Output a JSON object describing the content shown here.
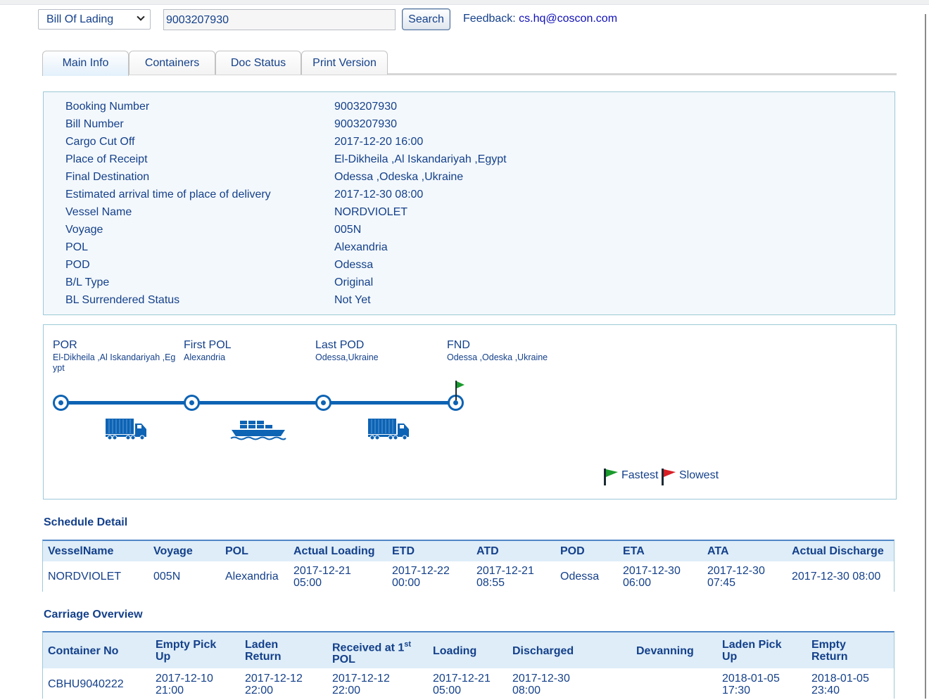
{
  "search": {
    "doc_type": "Bill Of Lading",
    "number": "9003207930",
    "button": "Search",
    "feedback_label": "Feedback:",
    "feedback_email": "cs.hq@coscon.com"
  },
  "tabs": [
    "Main Info",
    "Containers",
    "Doc Status",
    "Print Version"
  ],
  "main_info": [
    {
      "label": "Booking Number",
      "value": "9003207930"
    },
    {
      "label": "Bill Number",
      "value": "9003207930"
    },
    {
      "label": "Cargo Cut Off",
      "value": "2017-12-20 16:00"
    },
    {
      "label": "Place of Receipt",
      "value": "El-Dikheila ,Al Iskandariyah ,Egypt"
    },
    {
      "label": "Final Destination",
      "value": "Odessa ,Odeska ,Ukraine"
    },
    {
      "label": "Estimated arrival time of place of delivery",
      "value": "2017-12-30 08:00"
    },
    {
      "label": "Vessel Name",
      "value": "NORDVIOLET"
    },
    {
      "label": "Voyage",
      "value": "005N"
    },
    {
      "label": "POL",
      "value": "Alexandria"
    },
    {
      "label": "POD",
      "value": "Odessa"
    },
    {
      "label": "B/L Type",
      "value": "Original"
    },
    {
      "label": "BL Surrendered Status",
      "value": "Not Yet"
    }
  ],
  "route": {
    "stops": [
      {
        "name": "POR",
        "place": "El-Dikheila ,Al Iskandariyah ,Egypt"
      },
      {
        "name": "First POL",
        "place": "Alexandria"
      },
      {
        "name": "Last POD",
        "place": "Odessa,Ukraine"
      },
      {
        "name": "FND",
        "place": "Odessa ,Odeska ,Ukraine"
      }
    ],
    "legs": [
      "truck",
      "ship",
      "truck"
    ],
    "legend": {
      "fastest": "Fastest",
      "slowest": "Slowest"
    },
    "colors": {
      "route": "#0d63b4",
      "fastest_flag": "#1a9a2c",
      "slowest_flag": "#d81f26"
    }
  },
  "schedule": {
    "title": "Schedule Detail",
    "headers": [
      "VesselName",
      "Voyage",
      "POL",
      "Actual Loading",
      "ETD",
      "ATD",
      "POD",
      "ETA",
      "ATA",
      "Actual Discharge"
    ],
    "rows": [
      [
        "NORDVIOLET",
        "005N",
        "Alexandria",
        "2017-12-21 05:00",
        "2017-12-22 00:00",
        "2017-12-21 08:55",
        "Odessa",
        "2017-12-30 06:00",
        "2017-12-30 07:45",
        "2017-12-30 08:00"
      ]
    ]
  },
  "carriage": {
    "title": "Carriage Overview",
    "headers": [
      "Container No",
      "Empty Pick Up",
      "Laden Return",
      "Received at 1",
      "Loading",
      "Discharged",
      "Devanning",
      "Laden Pick Up",
      "Empty Return"
    ],
    "received_sup": "st",
    "received_suffix": "POL",
    "rows": [
      [
        "CBHU9040222",
        "2017-12-10 21:00",
        "2017-12-12 22:00",
        "2017-12-12 22:00",
        "2017-12-21 05:00",
        "2017-12-30 08:00",
        "",
        "2018-01-05 17:30",
        "2018-01-05 23:40"
      ]
    ]
  }
}
